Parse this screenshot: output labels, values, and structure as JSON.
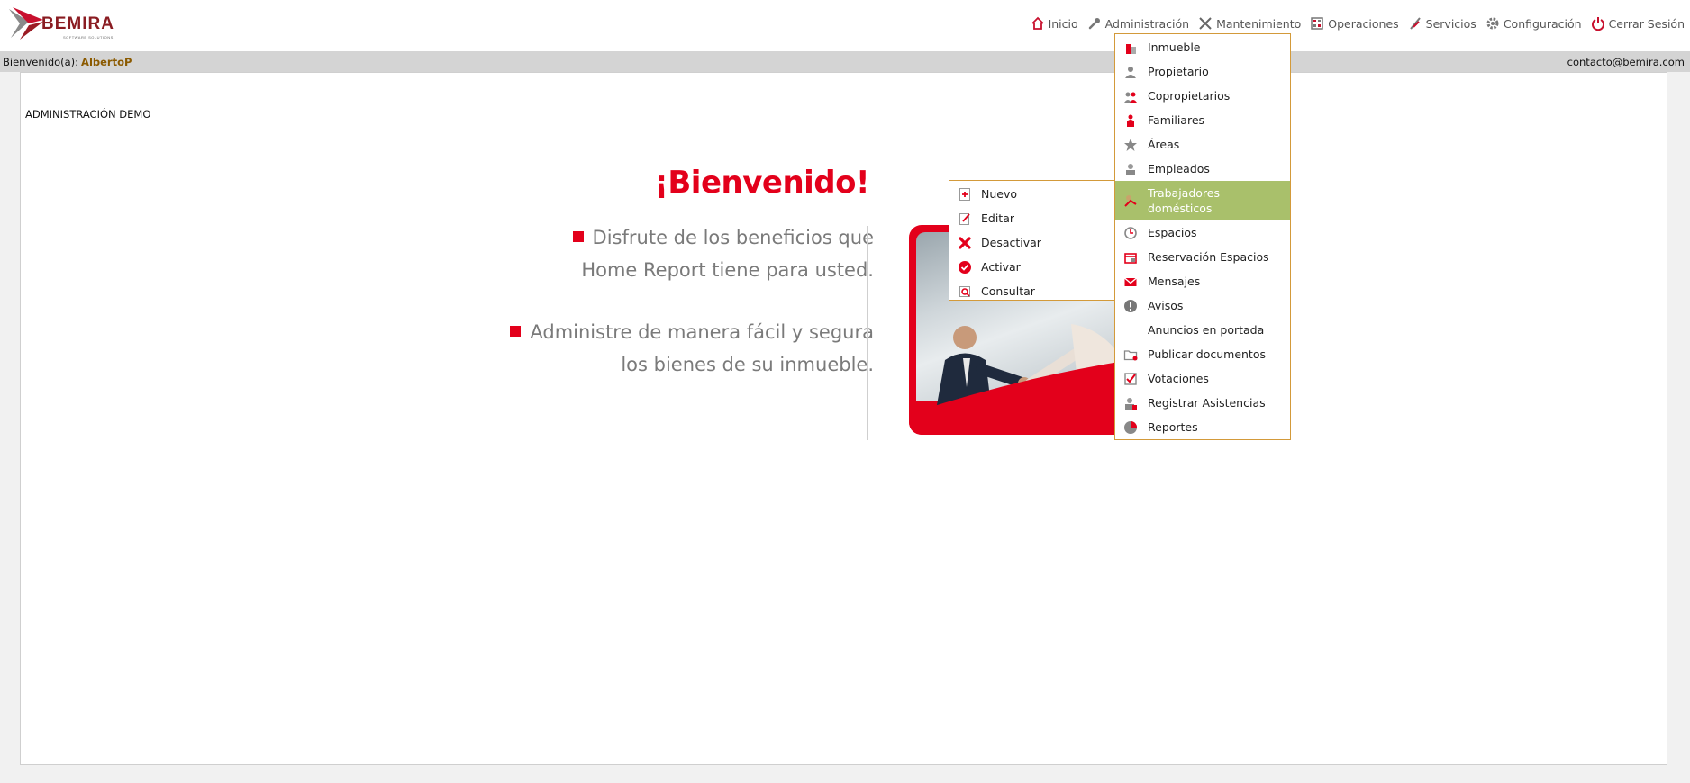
{
  "brand": {
    "name": "BEMIRA",
    "tagline": "SOFTWARE SOLUTIONS"
  },
  "nav": {
    "items": [
      {
        "label": "Inicio",
        "icon": "home-icon"
      },
      {
        "label": "Administración",
        "icon": "wrench-icon"
      },
      {
        "label": "Mantenimiento",
        "icon": "tools-icon"
      },
      {
        "label": "Operaciones",
        "icon": "calculator-icon"
      },
      {
        "label": "Servicios",
        "icon": "service-icon"
      },
      {
        "label": "Configuración",
        "icon": "gear-icon"
      },
      {
        "label": "Cerrar Sesión",
        "icon": "power-icon"
      }
    ]
  },
  "welcome": {
    "prefix": "Bienvenido(a):",
    "user": "AlbertoP",
    "email": "contacto@bemira.com"
  },
  "main": {
    "company": "ADMINISTRACIÓN DEMO",
    "title": "¡Bienvenido!",
    "bullets": [
      {
        "line1": "Disfrute de los beneficios que",
        "line2": "Home Report tiene para usted."
      },
      {
        "line1": "Administre de manera fácil y segura",
        "line2": "los bienes de su inmueble."
      }
    ]
  },
  "admin_menu": {
    "items": [
      {
        "label": "Inmueble",
        "icon": "building-icon"
      },
      {
        "label": "Propietario",
        "icon": "owner-icon"
      },
      {
        "label": "Copropietarios",
        "icon": "co-owners-icon"
      },
      {
        "label": "Familiares",
        "icon": "family-icon"
      },
      {
        "label": "Áreas",
        "icon": "star-icon"
      },
      {
        "label": "Empleados",
        "icon": "employee-icon"
      },
      {
        "label": "Trabajadores domésticos",
        "icon": "domestic-worker-icon"
      },
      {
        "label": "Espacios",
        "icon": "clock-icon"
      },
      {
        "label": "Reservación Espacios",
        "icon": "reservation-icon"
      },
      {
        "label": "Mensajes",
        "icon": "envelope-icon"
      },
      {
        "label": "Avisos",
        "icon": "alert-icon"
      },
      {
        "label": "Anuncios en portada",
        "icon": ""
      },
      {
        "label": "Publicar documentos",
        "icon": "folder-icon"
      },
      {
        "label": "Votaciones",
        "icon": "checkbox-icon"
      },
      {
        "label": "Registrar Asistencias",
        "icon": "attendance-icon"
      },
      {
        "label": "Reportes",
        "icon": "pie-chart-icon"
      }
    ],
    "highlighted": "Trabajadores domésticos"
  },
  "sub_menu": {
    "items": [
      {
        "label": "Nuevo",
        "icon": "plus-document-icon"
      },
      {
        "label": "Editar",
        "icon": "edit-icon"
      },
      {
        "label": "Desactivar",
        "icon": "x-icon"
      },
      {
        "label": "Activar",
        "icon": "check-circle-icon"
      },
      {
        "label": "Consultar",
        "icon": "search-document-icon"
      }
    ]
  },
  "colors": {
    "accent_red": "#e3001b",
    "menu_border": "#d39a3a",
    "menu_highlight": "#a9c06b",
    "username": "#8b5a00",
    "bar_gray": "#d4d4d4"
  }
}
